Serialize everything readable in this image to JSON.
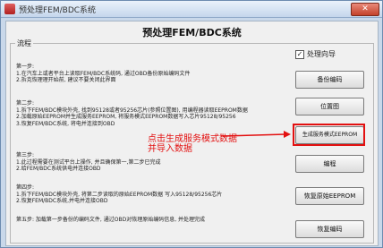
{
  "window": {
    "title": "预处理FEM/BDC系统",
    "close": "✕"
  },
  "heading": "预处理FEM/BDC系统",
  "group_label": "流程",
  "wizard_check": {
    "label": "处理向导",
    "checked": true
  },
  "steps": [
    {
      "lines": [
        "第一步:",
        "1.在汽车上或者平台上读取FEM/BDC系统码, 通过OBD备份原始编码文件",
        "2.拆克恢理理开始前, 建议不要关闭此界面"
      ]
    },
    {
      "lines": [
        "第二步:",
        "1.拆下FEM/BDC模块外壳, 找到95128或者95256芯片(参照位置图), 用编程器读取EEPROM数据",
        "2.加载原始EEPROM并生成服务EEPROM, 将服务模式EEPROM数据写入芯片95128/95256",
        "3.恢复FEM/BDC系统, 将电并连接到OBD"
      ]
    },
    {
      "lines": [
        "第三步:",
        "1.此过程需要在测试平台上操作, 并且确保第一,第二步已完成",
        "2.给FEM/BDC系统供电并连接OBD"
      ]
    },
    {
      "lines": [
        "第四步:",
        "1.拆下FEM/BDC模块外壳, 将第二步读取的原始EEPROM数据 写入95128/95256芯片",
        "2.恢复FEM/BDC系统,并电并连接OBD"
      ]
    },
    {
      "lines": [
        "第五步: 加载第一步备份的编码文件, 通过OBD对恢理原始编码信息, 并处理完成"
      ]
    }
  ],
  "buttons": {
    "backup": "备份编码",
    "position": "位置图",
    "generate": "生成服务模式EEPROM",
    "program": "编程",
    "restore": "恢复原始EEPROM",
    "write_code": "恢复编码"
  },
  "annotation": [
    "点击生成服务模式数据",
    "并导入数据"
  ],
  "colors": {
    "highlight": "#e31010",
    "titlebar": "#c4d6ec"
  }
}
